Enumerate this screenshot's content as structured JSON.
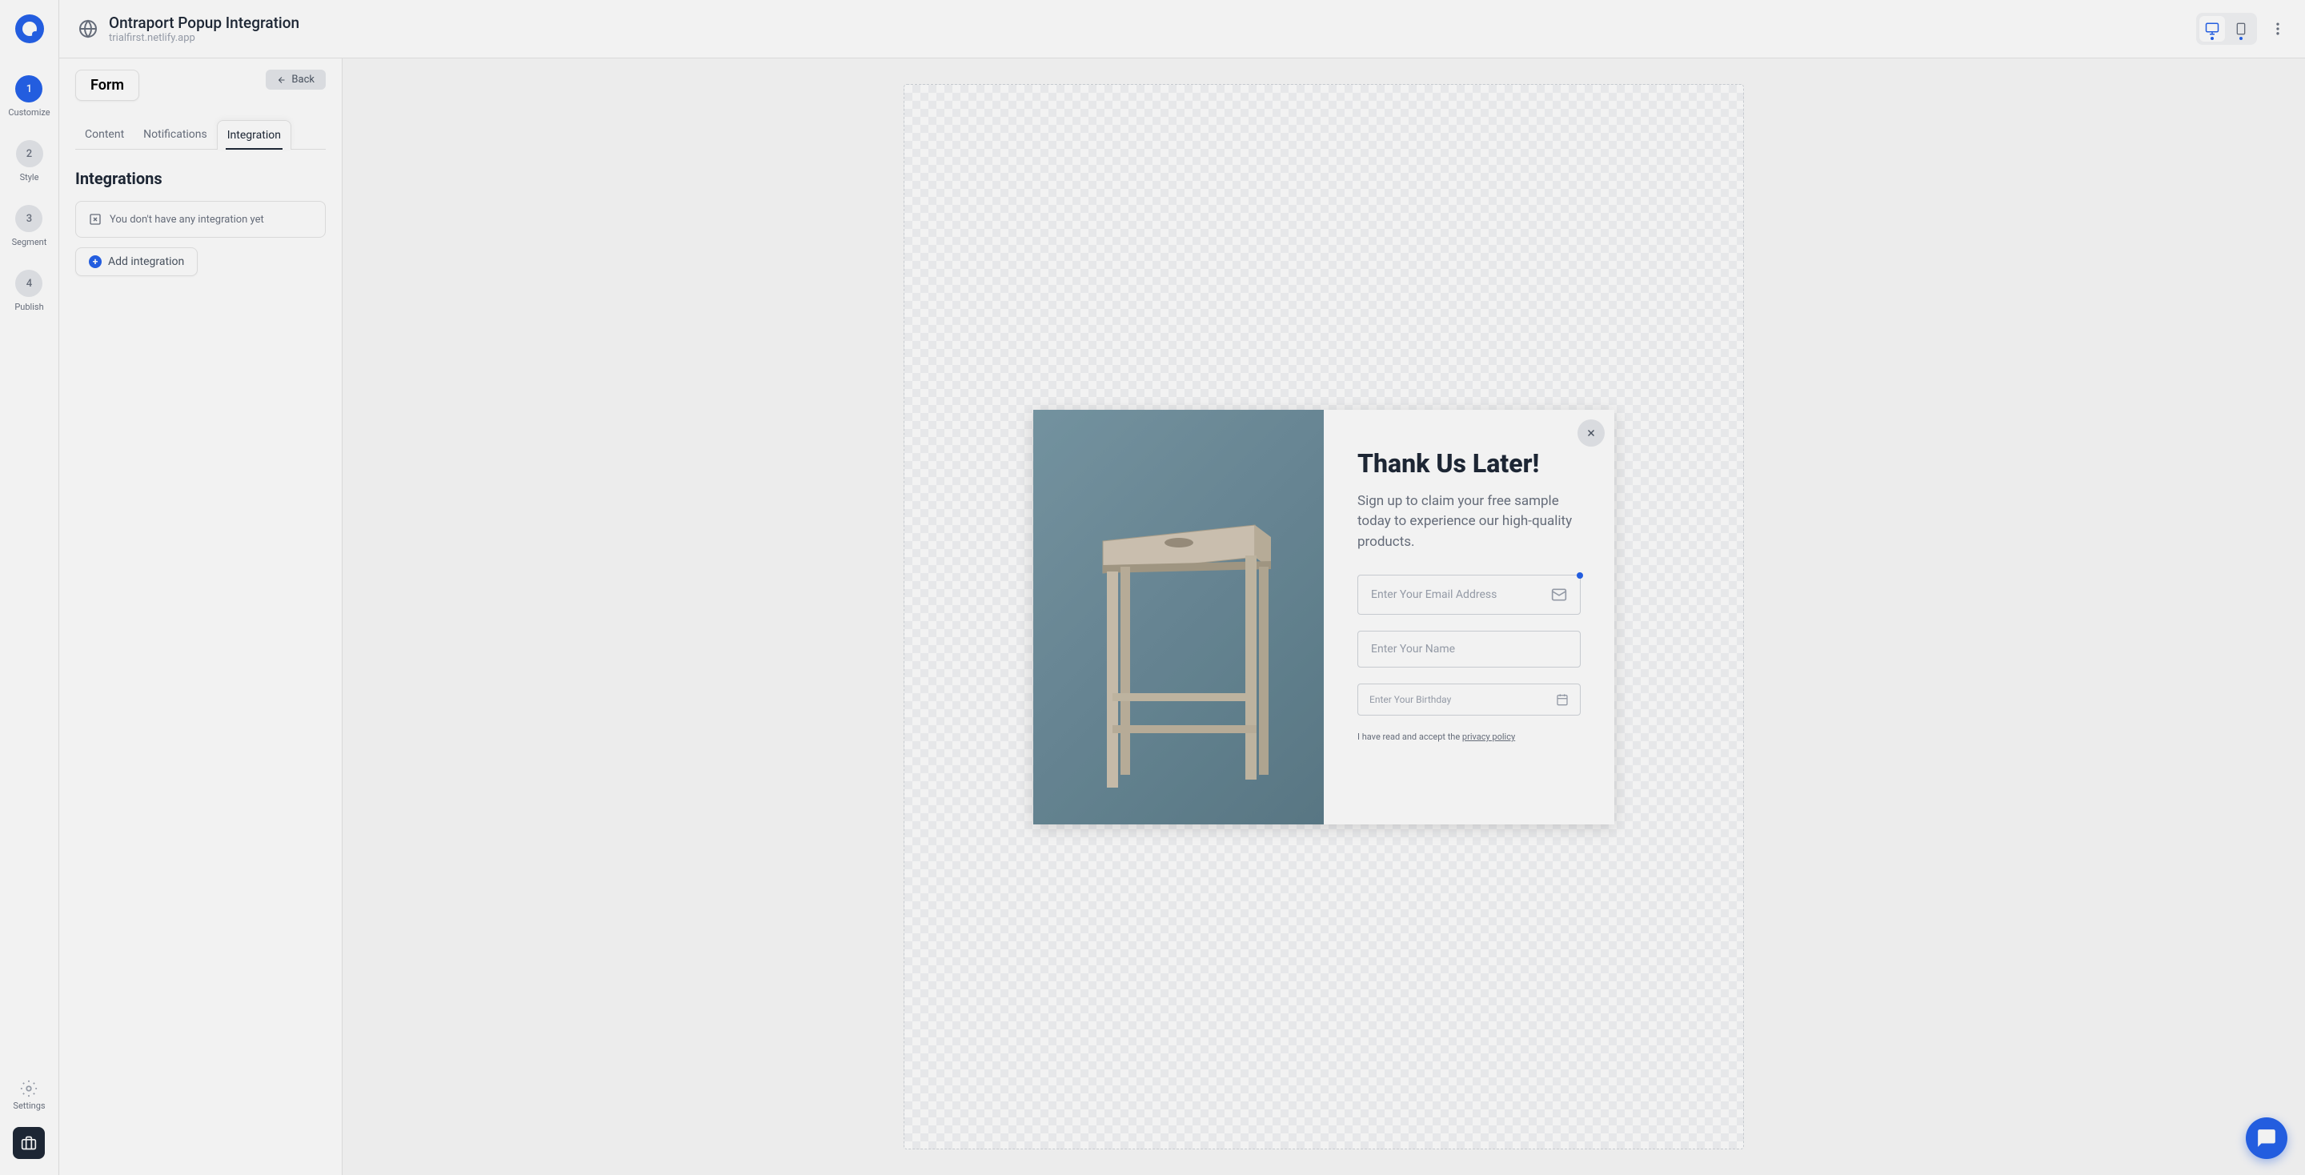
{
  "header": {
    "title": "Ontraport Popup Integration",
    "subtitle": "trialfirst.netlify.app"
  },
  "sidebar": {
    "steps": [
      {
        "num": "1",
        "label": "Customize",
        "active": true
      },
      {
        "num": "2",
        "label": "Style",
        "active": false
      },
      {
        "num": "3",
        "label": "Segment",
        "active": false
      },
      {
        "num": "4",
        "label": "Publish",
        "active": false
      }
    ],
    "settings_label": "Settings"
  },
  "panel": {
    "badge": "Form",
    "back_label": "Back",
    "tabs": [
      {
        "label": "Content",
        "active": false
      },
      {
        "label": "Notifications",
        "active": false
      },
      {
        "label": "Integration",
        "active": true
      }
    ],
    "section_title": "Integrations",
    "empty_message": "You don't have any integration yet",
    "add_button_label": "Add integration"
  },
  "popup": {
    "title": "Thank Us Later!",
    "description": "Sign up to claim your free sample today to experience our high-quality products.",
    "email_placeholder": "Enter Your Email Address",
    "name_placeholder": "Enter Your Name",
    "birthday_placeholder": "Enter Your Birthday",
    "consent_prefix": "I have read and accept the ",
    "consent_link": "privacy policy"
  }
}
